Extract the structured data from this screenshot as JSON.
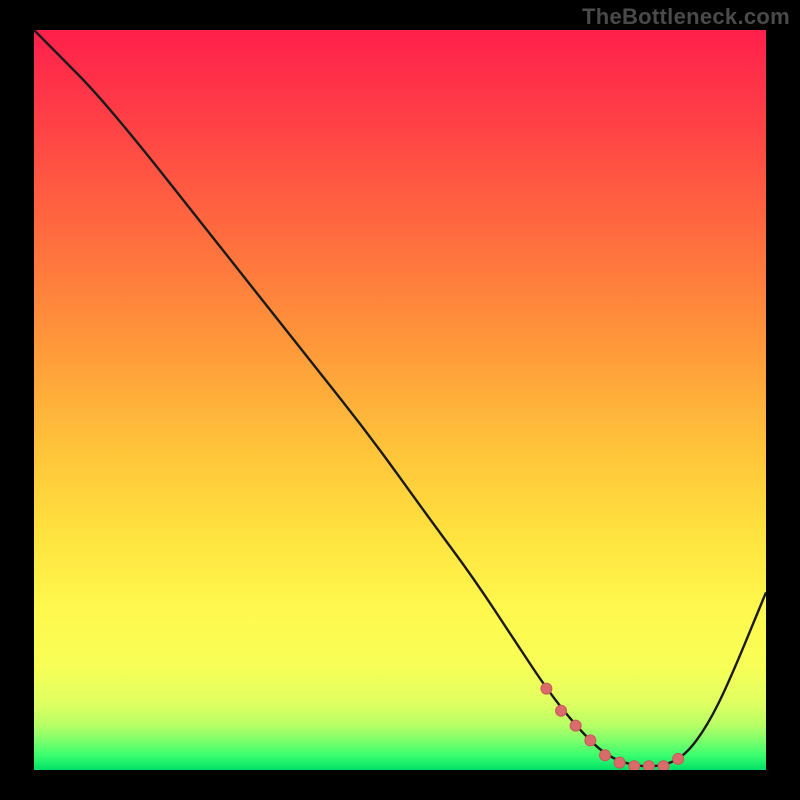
{
  "watermark": "TheBottleneck.com",
  "colors": {
    "curve": "#1a1a1a",
    "marker_fill": "#d96b6b",
    "marker_stroke": "#c85a5a"
  },
  "chart_data": {
    "type": "line",
    "title": "",
    "xlabel": "",
    "ylabel": "",
    "xlim": [
      0,
      100
    ],
    "ylim": [
      0,
      100
    ],
    "x": [
      0,
      4,
      8,
      14,
      22,
      30,
      38,
      46,
      54,
      60,
      66,
      70,
      74,
      78,
      82,
      86,
      89,
      92,
      95,
      100
    ],
    "y": [
      100,
      96,
      92,
      85,
      75,
      65,
      55,
      45,
      34,
      26,
      17,
      11,
      6,
      2,
      0.5,
      0.5,
      2,
      6,
      12,
      24
    ],
    "optimal_markers_x": [
      70,
      72,
      74,
      76,
      78,
      80,
      82,
      84,
      86,
      88
    ],
    "optimal_markers_y": [
      11,
      8,
      6,
      4,
      2,
      1,
      0.5,
      0.5,
      0.5,
      1.5
    ]
  }
}
